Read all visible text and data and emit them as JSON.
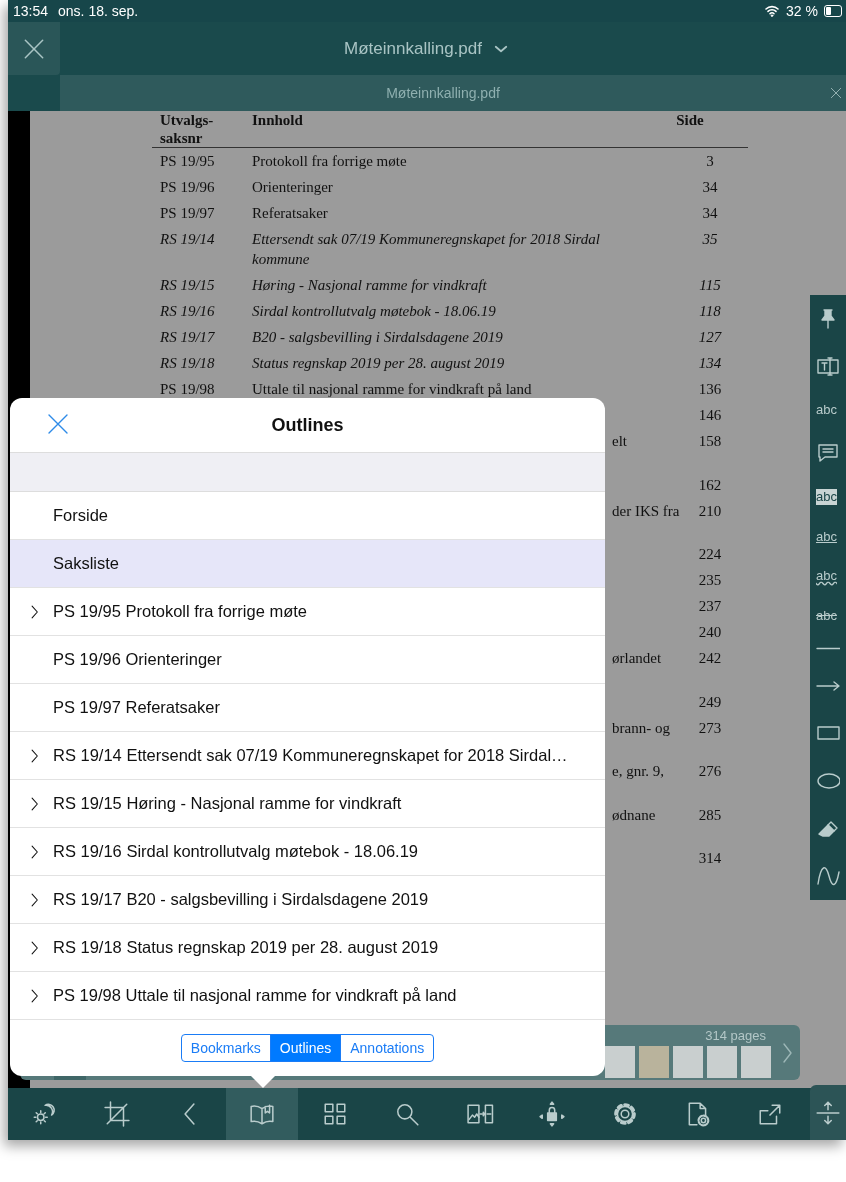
{
  "status_bar": {
    "time": "13:54",
    "date": "ons. 18. sep.",
    "battery": "32 %"
  },
  "title_bar": {
    "title": "Møteinnkalling.pdf"
  },
  "tab": {
    "label": "Møteinnkalling.pdf"
  },
  "document": {
    "headings": {
      "case": "Utvalgs-saksnr",
      "content": "Innhold",
      "page": "Side"
    },
    "rows": [
      {
        "case": "PS 19/95",
        "title": "Protokoll fra forrige møte",
        "page": "3",
        "italic": false,
        "kind": "single"
      },
      {
        "case": "PS 19/96",
        "title": "Orienteringer",
        "page": "34",
        "italic": false,
        "kind": "single"
      },
      {
        "case": "PS 19/97",
        "title": "Referatsaker",
        "page": "34",
        "italic": false,
        "kind": "single"
      },
      {
        "case": "RS 19/14",
        "title": "Ettersendt sak 07/19 Kommuneregnskapet for 2018 Sirdal kommune",
        "page": "35",
        "italic": true,
        "kind": "single"
      },
      {
        "case": "RS 19/15",
        "title": "Høring - Nasjonal ramme for vindkraft",
        "page": "115",
        "italic": true,
        "kind": "single"
      },
      {
        "case": "RS 19/16",
        "title": "Sirdal kontrollutvalg møtebok - 18.06.19",
        "page": "118",
        "italic": true,
        "kind": "single"
      },
      {
        "case": "RS 19/17",
        "title": "B20 - salgsbevilling i Sirdalsdagene 2019",
        "page": "127",
        "italic": true,
        "kind": "single"
      },
      {
        "case": "RS 19/18",
        "title": "Status regnskap 2019 per 28. august 2019",
        "page": "134",
        "italic": true,
        "kind": "single"
      },
      {
        "case": "PS 19/98",
        "title": "Uttale til nasjonal ramme for vindkraft på land",
        "page": "136",
        "italic": false,
        "kind": "single"
      },
      {
        "page": "146",
        "italic": false,
        "kind": "single"
      },
      {
        "title": "elt",
        "page": "158",
        "italic": false,
        "kind": "double"
      },
      {
        "page": "162",
        "italic": false,
        "kind": "single"
      },
      {
        "title": "der IKS fra",
        "page": "210",
        "italic": false,
        "kind": "double"
      },
      {
        "page": "224",
        "italic": false,
        "kind": "single"
      },
      {
        "page": "235",
        "italic": false,
        "kind": "single"
      },
      {
        "page": "237",
        "italic": false,
        "kind": "single"
      },
      {
        "page": "240",
        "italic": false,
        "kind": "single"
      },
      {
        "title": "ørlandet",
        "page": "242",
        "italic": false,
        "kind": "double"
      },
      {
        "page": "249",
        "italic": false,
        "kind": "single"
      },
      {
        "title": "brann- og",
        "page": "273",
        "italic": false,
        "kind": "double"
      },
      {
        "title": "e, gnr. 9,",
        "page": "276",
        "italic": false,
        "kind": "double"
      },
      {
        "title": "ødnane",
        "page": "285",
        "italic": false,
        "kind": "double"
      },
      {
        "page": "314",
        "italic": false,
        "kind": "single"
      }
    ]
  },
  "annotation_tools": [
    {
      "kind": "pin"
    },
    {
      "kind": "text-box"
    },
    {
      "kind": "text-insert",
      "label": "abc"
    },
    {
      "kind": "note"
    },
    {
      "kind": "highlight",
      "label": "abc"
    },
    {
      "kind": "underline",
      "label": "abc"
    },
    {
      "kind": "squiggly",
      "label": "abc"
    },
    {
      "kind": "strikeout",
      "label": "abc"
    },
    {
      "kind": "line"
    },
    {
      "kind": "arrow"
    },
    {
      "kind": "rectangle"
    },
    {
      "kind": "ellipse"
    },
    {
      "kind": "eraser"
    },
    {
      "kind": "freehand"
    }
  ],
  "thumbnail_strip": {
    "page_count": "314 pages"
  },
  "outlines": {
    "title": "Outlines",
    "items": [
      {
        "label": "Forside",
        "expandable": false,
        "selected": false
      },
      {
        "label": "Saksliste",
        "expandable": false,
        "selected": true
      },
      {
        "label": "PS 19/95 Protokoll fra forrige møte",
        "expandable": true,
        "selected": false
      },
      {
        "label": "PS 19/96 Orienteringer",
        "expandable": false,
        "selected": false
      },
      {
        "label": "PS 19/97 Referatsaker",
        "expandable": false,
        "selected": false
      },
      {
        "label": "RS 19/14 Ettersendt sak 07/19 Kommuneregnskapet for 2018 Sirdal…",
        "expandable": true,
        "selected": false
      },
      {
        "label": "RS 19/15 Høring - Nasjonal ramme for vindkraft",
        "expandable": true,
        "selected": false
      },
      {
        "label": "RS 19/16 Sirdal kontrollutvalg møtebok - 18.06.19",
        "expandable": true,
        "selected": false
      },
      {
        "label": "RS 19/17 B20 - salgsbevilling i Sirdalsdagene 2019",
        "expandable": true,
        "selected": false
      },
      {
        "label": "RS 19/18 Status regnskap 2019 per 28. august 2019",
        "expandable": true,
        "selected": false
      },
      {
        "label": "PS 19/98 Uttale til nasjonal ramme for vindkraft på land",
        "expandable": true,
        "selected": false
      }
    ],
    "segments": [
      {
        "label": "Bookmarks",
        "selected": false
      },
      {
        "label": "Outlines",
        "selected": true
      },
      {
        "label": "Annotations",
        "selected": false
      }
    ]
  },
  "toolbar": [
    {
      "kind": "brightness",
      "selected": false
    },
    {
      "kind": "crop",
      "selected": false
    },
    {
      "kind": "back",
      "selected": false
    },
    {
      "kind": "book",
      "selected": true
    },
    {
      "kind": "grid",
      "selected": false
    },
    {
      "kind": "search",
      "selected": false
    },
    {
      "kind": "image-to-text",
      "selected": false
    },
    {
      "kind": "move-lock",
      "selected": false
    },
    {
      "kind": "settings",
      "selected": false
    },
    {
      "kind": "document-settings",
      "selected": false
    },
    {
      "kind": "share",
      "selected": false
    },
    {
      "kind": "expand",
      "selected": false
    }
  ]
}
